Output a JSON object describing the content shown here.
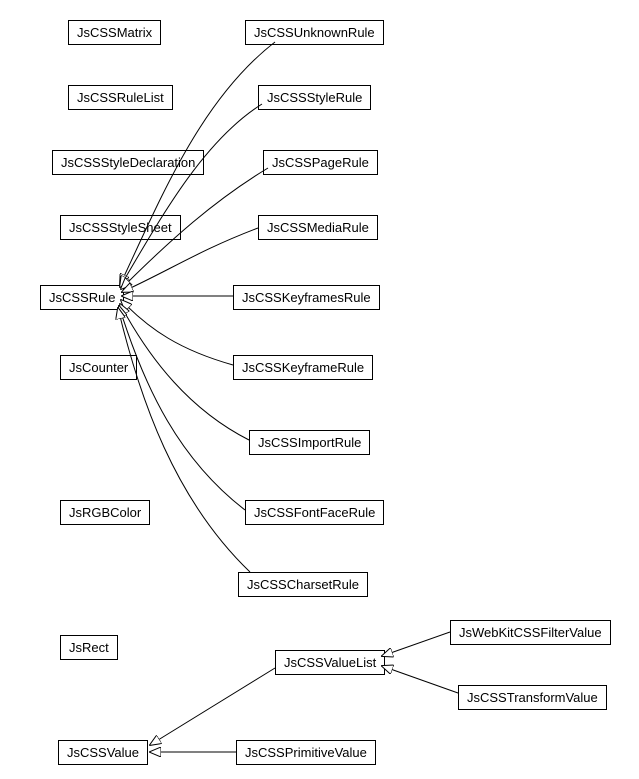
{
  "nodes": {
    "JsCSSMatrix": "JsCSSMatrix",
    "JsCSSUnknownRule": "JsCSSUnknownRule",
    "JsCSSRuleList": "JsCSSRuleList",
    "JsCSSStyleRule": "JsCSSStyleRule",
    "JsCSSStyleDeclaration": "JsCSSStyleDeclaration",
    "JsCSSPageRule": "JsCSSPageRule",
    "JsCSSStyleSheet": "JsCSSStyleSheet",
    "JsCSSMediaRule": "JsCSSMediaRule",
    "JsCSSRule": "JsCSSRule",
    "JsCSSKeyframesRule": "JsCSSKeyframesRule",
    "JsCounter": "JsCounter",
    "JsCSSKeyframeRule": "JsCSSKeyframeRule",
    "JsCSSImportRule": "JsCSSImportRule",
    "JsRGBColor": "JsRGBColor",
    "JsCSSFontFaceRule": "JsCSSFontFaceRule",
    "JsCSSCharsetRule": "JsCSSCharsetRule",
    "JsRect": "JsRect",
    "JsCSSValueList": "JsCSSValueList",
    "JsWebKitCSSFilterValue": "JsWebKitCSSFilterValue",
    "JsCSSTransformValue": "JsCSSTransformValue",
    "JsCSSValue": "JsCSSValue",
    "JsCSSPrimitiveValue": "JsCSSPrimitiveValue"
  },
  "edges": [
    {
      "from": "JsCSSUnknownRule",
      "to": "JsCSSRule"
    },
    {
      "from": "JsCSSStyleRule",
      "to": "JsCSSRule"
    },
    {
      "from": "JsCSSPageRule",
      "to": "JsCSSRule"
    },
    {
      "from": "JsCSSMediaRule",
      "to": "JsCSSRule"
    },
    {
      "from": "JsCSSKeyframesRule",
      "to": "JsCSSRule"
    },
    {
      "from": "JsCSSKeyframeRule",
      "to": "JsCSSRule"
    },
    {
      "from": "JsCSSImportRule",
      "to": "JsCSSRule"
    },
    {
      "from": "JsCSSFontFaceRule",
      "to": "JsCSSRule"
    },
    {
      "from": "JsCSSCharsetRule",
      "to": "JsCSSRule"
    },
    {
      "from": "JsWebKitCSSFilterValue",
      "to": "JsCSSValueList"
    },
    {
      "from": "JsCSSTransformValue",
      "to": "JsCSSValueList"
    },
    {
      "from": "JsCSSValueList",
      "to": "JsCSSValue"
    },
    {
      "from": "JsCSSPrimitiveValue",
      "to": "JsCSSValue"
    }
  ]
}
